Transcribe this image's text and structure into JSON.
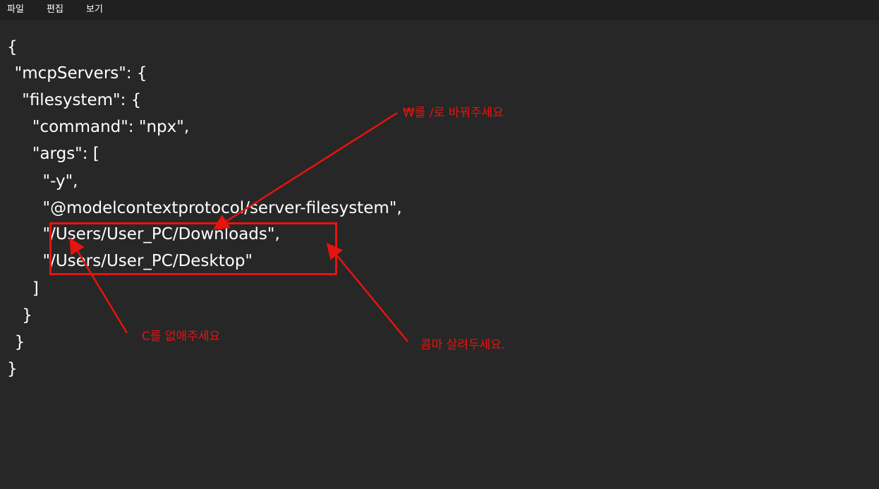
{
  "menu": {
    "file": "파일",
    "edit": "편집",
    "view": "보기"
  },
  "editor": {
    "lines": [
      "{",
      "  \"mcpServers\": {",
      "    \"filesystem\": {",
      "      \"command\": \"npx\",",
      "      \"args\": [",
      "        \"-y\",",
      "        \"@modelcontextprotocol/server-filesystem\",",
      "        \"/Users/User_PC/Downloads\",",
      "        \"/Users/User_PC/Desktop\"",
      "      ]",
      "    }",
      "  }",
      "}"
    ]
  },
  "annotations": {
    "slash_note": "₩를 /로 바꿔주세요",
    "remove_c_note": "C를 없애주세요",
    "keep_comma_note": "콤마 살려두세요.",
    "color": "#e8130d"
  }
}
